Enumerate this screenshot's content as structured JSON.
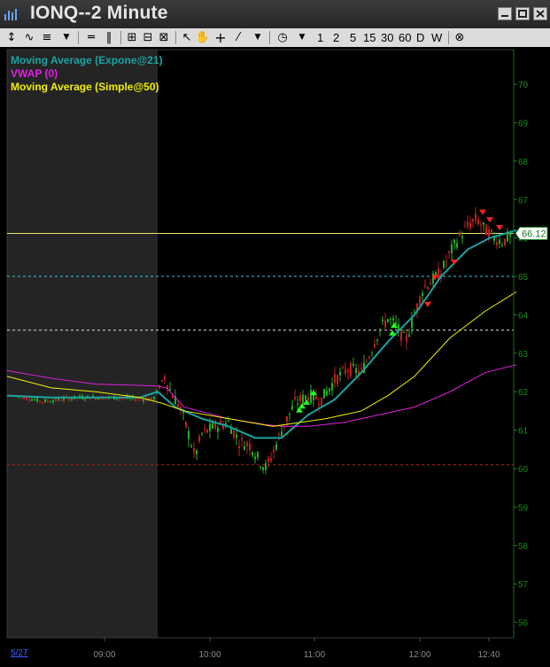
{
  "window": {
    "title": "IONQ--2 Minute"
  },
  "toolbar": {
    "timeframes": [
      "1",
      "2",
      "5",
      "15",
      "30",
      "60",
      "D",
      "W"
    ]
  },
  "legend": [
    {
      "label": "Moving Average (Expone@21)",
      "color": "#1aa3a3"
    },
    {
      "label": "VWAP (0)",
      "color": "#e020e0"
    },
    {
      "label": "Moving Average (Simple@50)",
      "color": "#f0f000"
    }
  ],
  "chart_data": {
    "type": "line",
    "y_ticks": [
      56,
      57,
      58,
      59,
      60,
      61,
      62,
      63,
      64,
      65,
      66,
      67,
      68,
      69,
      70
    ],
    "ylim": [
      55.6,
      70.9
    ],
    "x_tick_labels": [
      "09:00",
      "10:00",
      "11:00",
      "12:00",
      "12:40"
    ],
    "date_label": "5/27",
    "current_price": 66.12,
    "horizontal_lines": [
      {
        "value": 66.12,
        "color": "#e8e870",
        "style": "solid"
      },
      {
        "value": 65.0,
        "color": "#30d0d0",
        "style": "dashed"
      },
      {
        "value": 63.6,
        "color": "#e0e0e0",
        "style": "dashed"
      },
      {
        "value": 60.1,
        "color": "#b02020",
        "style": "dashed"
      }
    ],
    "series": [
      {
        "name": "Moving Average (Expone@21)",
        "color": "#1aa3a3",
        "x": [
          0,
          50,
          100,
          150,
          170,
          190,
          220,
          250,
          280,
          310,
          340,
          370,
          400,
          430,
          460,
          490,
          520,
          545,
          575
        ],
        "y": [
          61.9,
          61.85,
          61.85,
          61.85,
          62.0,
          61.6,
          61.3,
          61.1,
          60.8,
          60.8,
          61.4,
          61.8,
          62.5,
          63.3,
          64.0,
          65.0,
          65.7,
          66.0,
          66.2
        ]
      },
      {
        "name": "VWAP (0)",
        "color": "#e020e0",
        "x": [
          0,
          50,
          100,
          170,
          180,
          200,
          250,
          290,
          310,
          340,
          380,
          420,
          460,
          500,
          540,
          575
        ],
        "y": [
          62.55,
          62.35,
          62.2,
          62.15,
          62.1,
          61.6,
          61.3,
          61.15,
          61.1,
          61.1,
          61.2,
          61.4,
          61.6,
          62.0,
          62.5,
          62.7
        ]
      },
      {
        "name": "Moving Average (Simple@50)",
        "color": "#f0f000",
        "x": [
          0,
          50,
          100,
          150,
          175,
          200,
          250,
          300,
          330,
          360,
          400,
          430,
          460,
          500,
          540,
          575
        ],
        "y": [
          62.4,
          62.1,
          62.0,
          61.85,
          61.7,
          61.5,
          61.3,
          61.1,
          61.2,
          61.3,
          61.5,
          61.9,
          62.4,
          63.4,
          64.1,
          64.6
        ]
      }
    ],
    "price_path": {
      "x": [
        10,
        40,
        80,
        120,
        165,
        178,
        185,
        195,
        205,
        212,
        220,
        235,
        250,
        262,
        275,
        285,
        293,
        300,
        312,
        325,
        340,
        355,
        370,
        385,
        400,
        410,
        420,
        430,
        440,
        450,
        460,
        470,
        480,
        490,
        500,
        510,
        520,
        530,
        540,
        550,
        560,
        570
      ],
      "y": [
        61.9,
        61.75,
        61.85,
        61.85,
        61.8,
        62.4,
        62.0,
        61.6,
        60.9,
        60.3,
        60.9,
        61.1,
        61.2,
        60.7,
        60.6,
        60.2,
        60.0,
        60.4,
        61.1,
        61.7,
        61.9,
        61.8,
        62.3,
        62.6,
        62.5,
        63.0,
        63.6,
        63.9,
        63.7,
        63.3,
        64.0,
        64.7,
        64.9,
        65.1,
        65.6,
        66.0,
        66.3,
        66.5,
        66.2,
        66.0,
        65.9,
        66.1
      ]
    },
    "buy_signals": [
      [
        330,
        61.6
      ],
      [
        333,
        61.7
      ],
      [
        338,
        61.8
      ],
      [
        346,
        62.05
      ],
      [
        435,
        63.6
      ],
      [
        437,
        63.8
      ]
    ],
    "sell_signals": [
      [
        475,
        64.2
      ],
      [
        483,
        64.9
      ],
      [
        505,
        65.3
      ],
      [
        537,
        66.6
      ],
      [
        545,
        66.4
      ],
      [
        556,
        66.2
      ]
    ],
    "pre_market_end_x": 178
  }
}
